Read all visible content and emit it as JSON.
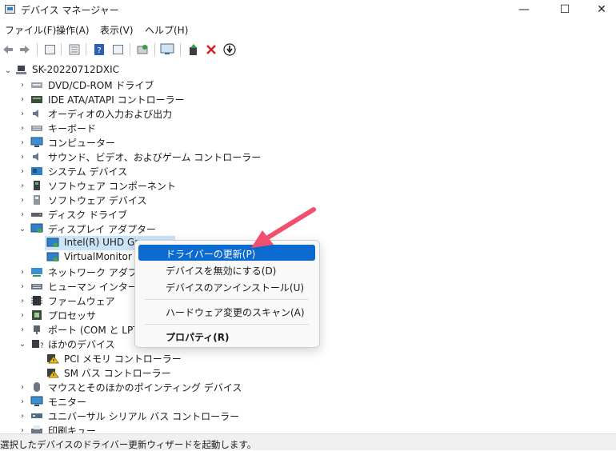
{
  "window": {
    "title": "デバイス マネージャー",
    "minimize": "—",
    "maximize": "☐",
    "close": "✕"
  },
  "menu": [
    "ファイル(F)",
    "操作(A)",
    "表示(V)",
    "ヘルプ(H)"
  ],
  "toolbar": {
    "icons": [
      "back-icon",
      "forward-icon",
      "properties-icon",
      "list-icon",
      "help-icon",
      "view-icon",
      "scan-icon",
      "monitor-icon",
      "update-driver-icon",
      "uninstall-icon",
      "disable-icon"
    ]
  },
  "tree": {
    "root": "SK-20220712DXIC",
    "items": [
      "DVD/CD-ROM ドライブ",
      "IDE ATA/ATAPI コントローラー",
      "オーディオの入力および出力",
      "キーボード",
      "コンピューター",
      "サウンド、ビデオ、およびゲーム コントローラー",
      "システム デバイス",
      "ソフトウェア コンポーネント",
      "ソフトウェア デバイス",
      "ディスク ドライブ",
      "ディスプレイ アダプター",
      "Intel(R) UHD Grap",
      "VirtualMonitor D",
      "ネットワーク アダプター",
      "ヒューマン インターフェイ",
      "ファームウェア",
      "プロセッサ",
      "ポート (COM と LPT)",
      "ほかのデバイス",
      "PCI メモリ コントローラー",
      "SM バス コントローラー",
      "マウスとそのほかのポインティング デバイス",
      "モニター",
      "ユニバーサル シリアル バス コントローラー",
      "印刷キュー"
    ]
  },
  "context_menu": {
    "update": "ドライバーの更新(P)",
    "disable": "デバイスを無効にする(D)",
    "uninstall": "デバイスのアンインストール(U)",
    "scan": "ハードウェア変更のスキャン(A)",
    "properties": "プロパティ(R)"
  },
  "status": "選択したデバイスのドライバー更新ウィザードを起動します。",
  "colors": {
    "highlight": "#0a6ad0",
    "selection": "#cce4f7",
    "arrow": "#f0506e"
  }
}
